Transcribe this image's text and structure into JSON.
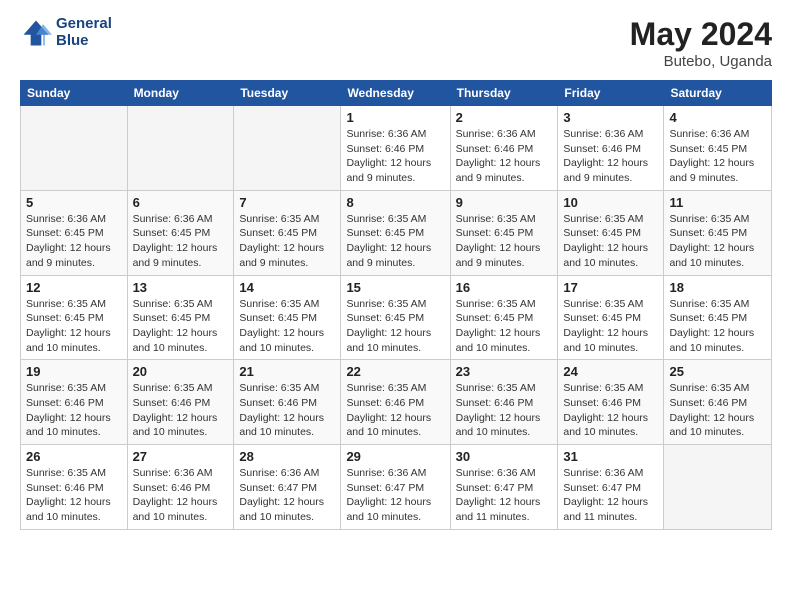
{
  "header": {
    "logo_line1": "General",
    "logo_line2": "Blue",
    "month_year": "May 2024",
    "location": "Butebo, Uganda"
  },
  "weekdays": [
    "Sunday",
    "Monday",
    "Tuesday",
    "Wednesday",
    "Thursday",
    "Friday",
    "Saturday"
  ],
  "weeks": [
    [
      {
        "day": "",
        "info": ""
      },
      {
        "day": "",
        "info": ""
      },
      {
        "day": "",
        "info": ""
      },
      {
        "day": "1",
        "info": "Sunrise: 6:36 AM\nSunset: 6:46 PM\nDaylight: 12 hours\nand 9 minutes."
      },
      {
        "day": "2",
        "info": "Sunrise: 6:36 AM\nSunset: 6:46 PM\nDaylight: 12 hours\nand 9 minutes."
      },
      {
        "day": "3",
        "info": "Sunrise: 6:36 AM\nSunset: 6:46 PM\nDaylight: 12 hours\nand 9 minutes."
      },
      {
        "day": "4",
        "info": "Sunrise: 6:36 AM\nSunset: 6:45 PM\nDaylight: 12 hours\nand 9 minutes."
      }
    ],
    [
      {
        "day": "5",
        "info": "Sunrise: 6:36 AM\nSunset: 6:45 PM\nDaylight: 12 hours\nand 9 minutes."
      },
      {
        "day": "6",
        "info": "Sunrise: 6:36 AM\nSunset: 6:45 PM\nDaylight: 12 hours\nand 9 minutes."
      },
      {
        "day": "7",
        "info": "Sunrise: 6:35 AM\nSunset: 6:45 PM\nDaylight: 12 hours\nand 9 minutes."
      },
      {
        "day": "8",
        "info": "Sunrise: 6:35 AM\nSunset: 6:45 PM\nDaylight: 12 hours\nand 9 minutes."
      },
      {
        "day": "9",
        "info": "Sunrise: 6:35 AM\nSunset: 6:45 PM\nDaylight: 12 hours\nand 9 minutes."
      },
      {
        "day": "10",
        "info": "Sunrise: 6:35 AM\nSunset: 6:45 PM\nDaylight: 12 hours\nand 10 minutes."
      },
      {
        "day": "11",
        "info": "Sunrise: 6:35 AM\nSunset: 6:45 PM\nDaylight: 12 hours\nand 10 minutes."
      }
    ],
    [
      {
        "day": "12",
        "info": "Sunrise: 6:35 AM\nSunset: 6:45 PM\nDaylight: 12 hours\nand 10 minutes."
      },
      {
        "day": "13",
        "info": "Sunrise: 6:35 AM\nSunset: 6:45 PM\nDaylight: 12 hours\nand 10 minutes."
      },
      {
        "day": "14",
        "info": "Sunrise: 6:35 AM\nSunset: 6:45 PM\nDaylight: 12 hours\nand 10 minutes."
      },
      {
        "day": "15",
        "info": "Sunrise: 6:35 AM\nSunset: 6:45 PM\nDaylight: 12 hours\nand 10 minutes."
      },
      {
        "day": "16",
        "info": "Sunrise: 6:35 AM\nSunset: 6:45 PM\nDaylight: 12 hours\nand 10 minutes."
      },
      {
        "day": "17",
        "info": "Sunrise: 6:35 AM\nSunset: 6:45 PM\nDaylight: 12 hours\nand 10 minutes."
      },
      {
        "day": "18",
        "info": "Sunrise: 6:35 AM\nSunset: 6:45 PM\nDaylight: 12 hours\nand 10 minutes."
      }
    ],
    [
      {
        "day": "19",
        "info": "Sunrise: 6:35 AM\nSunset: 6:46 PM\nDaylight: 12 hours\nand 10 minutes."
      },
      {
        "day": "20",
        "info": "Sunrise: 6:35 AM\nSunset: 6:46 PM\nDaylight: 12 hours\nand 10 minutes."
      },
      {
        "day": "21",
        "info": "Sunrise: 6:35 AM\nSunset: 6:46 PM\nDaylight: 12 hours\nand 10 minutes."
      },
      {
        "day": "22",
        "info": "Sunrise: 6:35 AM\nSunset: 6:46 PM\nDaylight: 12 hours\nand 10 minutes."
      },
      {
        "day": "23",
        "info": "Sunrise: 6:35 AM\nSunset: 6:46 PM\nDaylight: 12 hours\nand 10 minutes."
      },
      {
        "day": "24",
        "info": "Sunrise: 6:35 AM\nSunset: 6:46 PM\nDaylight: 12 hours\nand 10 minutes."
      },
      {
        "day": "25",
        "info": "Sunrise: 6:35 AM\nSunset: 6:46 PM\nDaylight: 12 hours\nand 10 minutes."
      }
    ],
    [
      {
        "day": "26",
        "info": "Sunrise: 6:35 AM\nSunset: 6:46 PM\nDaylight: 12 hours\nand 10 minutes."
      },
      {
        "day": "27",
        "info": "Sunrise: 6:36 AM\nSunset: 6:46 PM\nDaylight: 12 hours\nand 10 minutes."
      },
      {
        "day": "28",
        "info": "Sunrise: 6:36 AM\nSunset: 6:47 PM\nDaylight: 12 hours\nand 10 minutes."
      },
      {
        "day": "29",
        "info": "Sunrise: 6:36 AM\nSunset: 6:47 PM\nDaylight: 12 hours\nand 10 minutes."
      },
      {
        "day": "30",
        "info": "Sunrise: 6:36 AM\nSunset: 6:47 PM\nDaylight: 12 hours\nand 11 minutes."
      },
      {
        "day": "31",
        "info": "Sunrise: 6:36 AM\nSunset: 6:47 PM\nDaylight: 12 hours\nand 11 minutes."
      },
      {
        "day": "",
        "info": ""
      }
    ]
  ]
}
